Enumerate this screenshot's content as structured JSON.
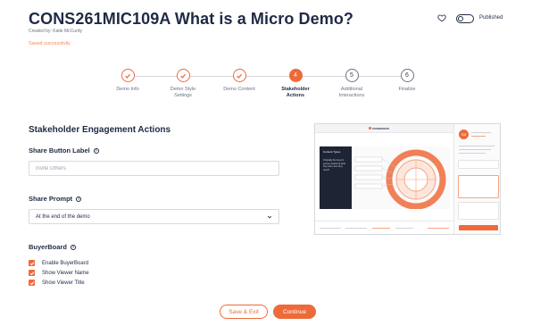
{
  "header": {
    "title": "CONS261MIC109A What is a Micro Demo?",
    "created_by": "Created by: Katie McCurdy",
    "saved_status": "Saved successfully",
    "published_label": "Published",
    "published_on": false
  },
  "stepper": {
    "steps": [
      {
        "number": "1",
        "label_lines": [
          "Demo Info"
        ],
        "state": "done"
      },
      {
        "number": "2",
        "label_lines": [
          "Demo Style",
          "Settings"
        ],
        "state": "done"
      },
      {
        "number": "3",
        "label_lines": [
          "Demo Content"
        ],
        "state": "done"
      },
      {
        "number": "4",
        "label_lines": [
          "Stakeholder",
          "Actions"
        ],
        "state": "active"
      },
      {
        "number": "5",
        "label_lines": [
          "Additional",
          "Interactions"
        ],
        "state": "todo"
      },
      {
        "number": "6",
        "label_lines": [
          "Finalize"
        ],
        "state": "todo"
      }
    ]
  },
  "form": {
    "section_title": "Stakeholder Engagement Actions",
    "share_button_label": "Share Button Label",
    "share_button_placeholder": "Invite Others",
    "share_button_value": "",
    "share_prompt_label": "Share Prompt",
    "share_prompt_value": "At the end of the demo",
    "buyerboard_label": "BuyerBoard",
    "checkboxes": [
      {
        "label": "Enable BuyerBoard",
        "checked": true
      },
      {
        "label": "Show Viewer Name",
        "checked": true
      },
      {
        "label": "Show Viewer Title",
        "checked": true
      }
    ]
  },
  "buttons": {
    "save_exit": "Save & Exit",
    "continue": "Continue"
  },
  "preview": {
    "logo_text": "CONSENSUS",
    "panel_title": "Content Types",
    "panel_text": "Originally the buyer's journey looked at what they were sure they need?",
    "avatar_initials": "KM"
  },
  "colors": {
    "accent": "#ee6a3a",
    "text": "#1f2a44",
    "muted": "#6b7280",
    "border": "#d6d9de"
  }
}
